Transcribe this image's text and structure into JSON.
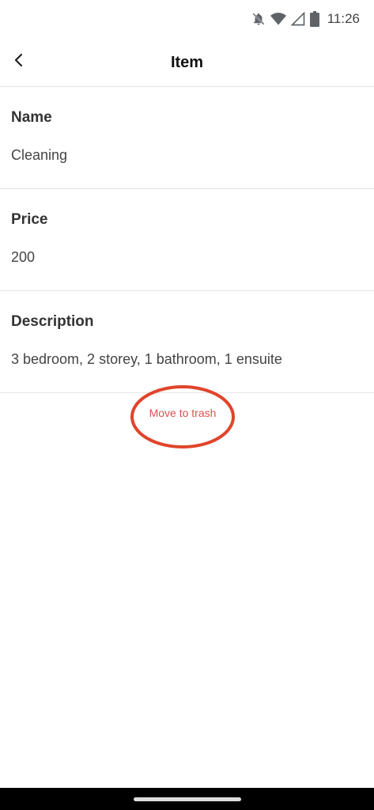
{
  "status_bar": {
    "time": "11:26",
    "icons": [
      "bell-off-icon",
      "wifi-icon",
      "signal-icon",
      "battery-icon"
    ]
  },
  "header": {
    "title": "Item",
    "back_icon": "back-arrow-icon"
  },
  "fields": [
    {
      "label": "Name",
      "value": "Cleaning"
    },
    {
      "label": "Price",
      "value": "200"
    },
    {
      "label": "Description",
      "value": "3 bedroom, 2 storey, 1 bathroom, 1 ensuite"
    }
  ],
  "actions": {
    "trash_label": "Move to trash"
  },
  "colors": {
    "danger": "#d9534f",
    "annotation": "#e0442b"
  }
}
